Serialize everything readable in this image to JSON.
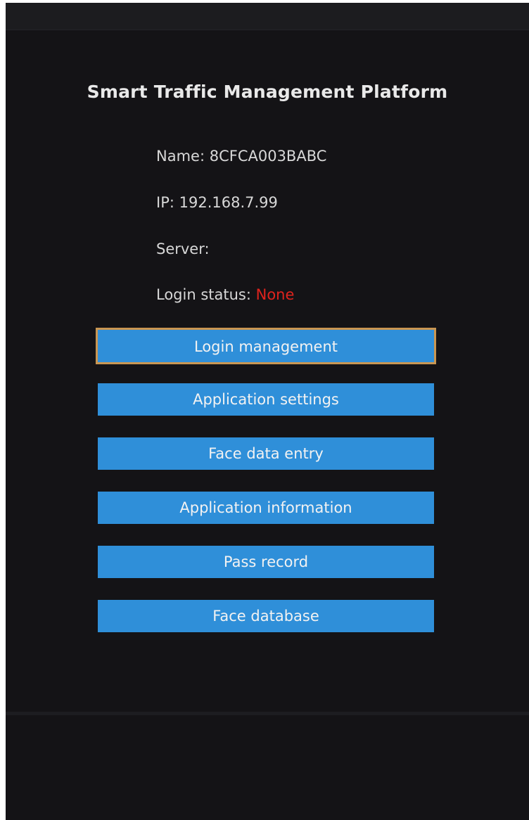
{
  "app": {
    "title": "Smart Traffic Management Platform"
  },
  "device": {
    "name_label": "Name: ",
    "name_value": "8CFCA003BABC",
    "ip_label": "IP: ",
    "ip_value": "192.168.7.99",
    "server_label": "Server:",
    "server_value": "",
    "login_label": "Login status: ",
    "login_value": "None",
    "login_value_color": "#e0231d"
  },
  "menu": {
    "login_management": "Login management",
    "application_settings": "Application settings",
    "face_data_entry": "Face data entry",
    "application_information": "Application information",
    "pass_record": "Pass record",
    "face_database": "Face database"
  },
  "colors": {
    "background": "#141316",
    "button": "#2f8fd9",
    "focus_border": "#c99652",
    "text": "#d8d8d8"
  }
}
